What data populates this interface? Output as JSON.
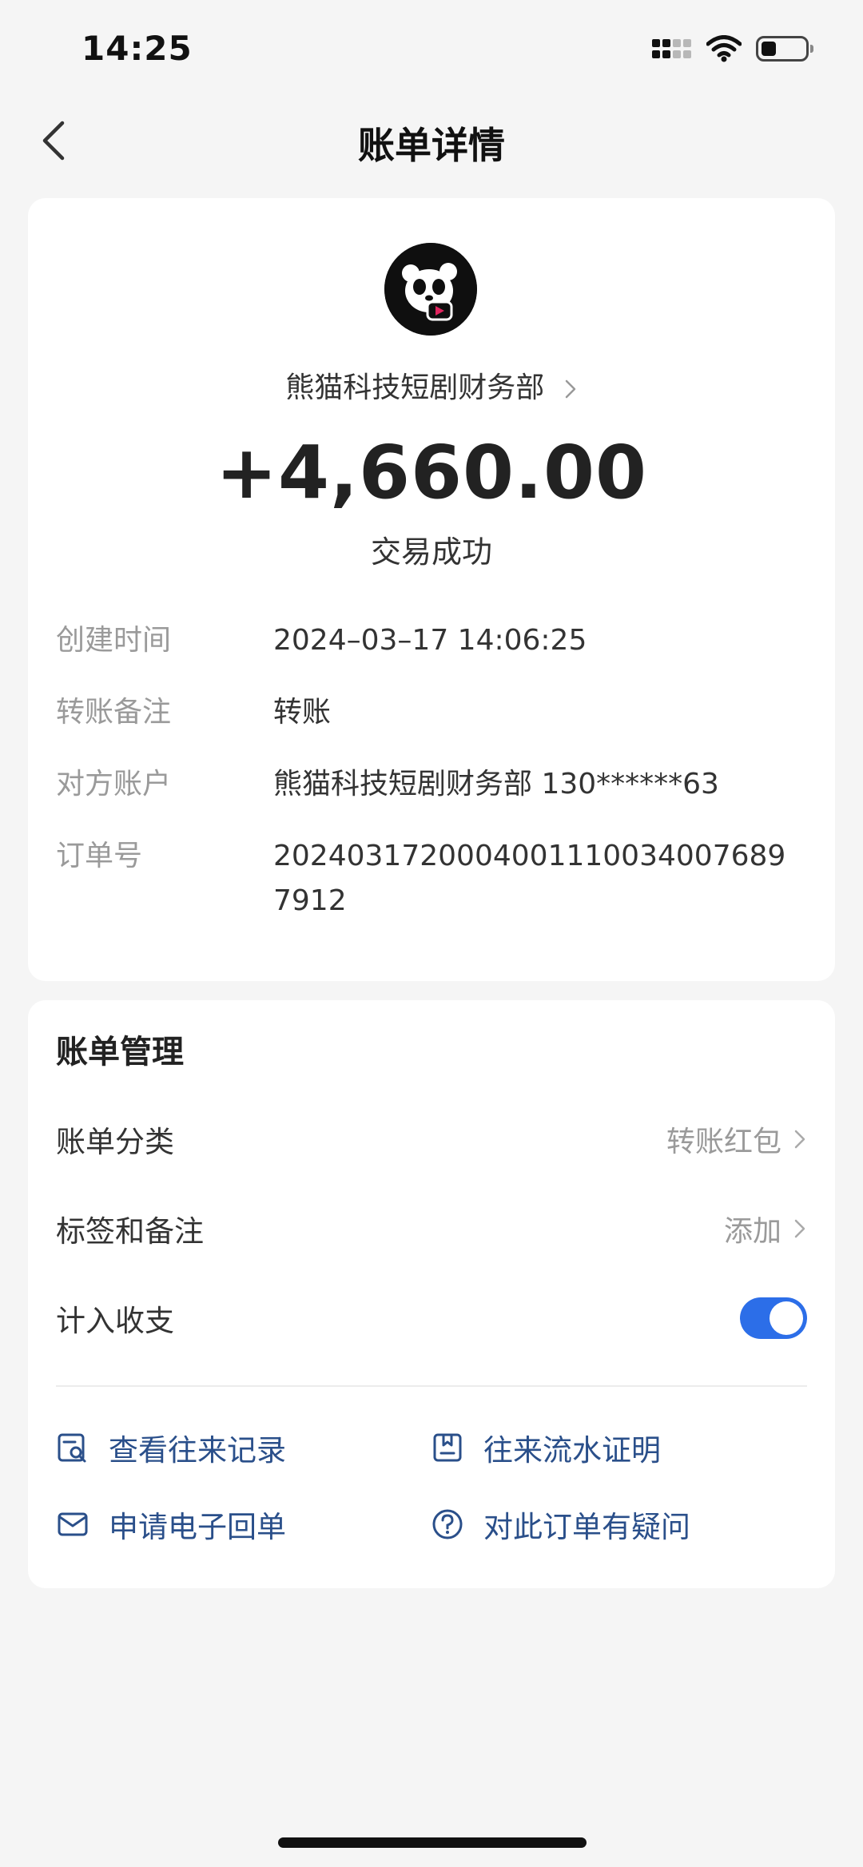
{
  "status_bar": {
    "time": "14:25"
  },
  "nav": {
    "title": "账单详情"
  },
  "transaction": {
    "merchant_name": "熊猫科技短剧财务部",
    "amount": "+4,660.00",
    "status": "交易成功",
    "details": [
      {
        "label": "创建时间",
        "value": "2024–03–17 14:06:25"
      },
      {
        "label": "转账备注",
        "value": "转账"
      },
      {
        "label": "对方账户",
        "value": "熊猫科技短剧财务部 130******63"
      },
      {
        "label": "订单号",
        "value": "20240317200040011100340076897912"
      }
    ]
  },
  "management": {
    "title": "账单管理",
    "category_label": "账单分类",
    "category_value": "转账红包",
    "tags_label": "标签和备注",
    "tags_value": "添加",
    "include_label": "计入收支",
    "include_enabled": true,
    "actions": [
      {
        "label": "查看往来记录",
        "icon": "search-record-icon"
      },
      {
        "label": "往来流水证明",
        "icon": "document-icon"
      },
      {
        "label": "申请电子回单",
        "icon": "mail-icon"
      },
      {
        "label": "对此订单有疑问",
        "icon": "question-icon"
      }
    ]
  },
  "colors": {
    "accent": "#2c6ee8",
    "link": "#2a4f8a",
    "muted": "#9a9a9a"
  }
}
